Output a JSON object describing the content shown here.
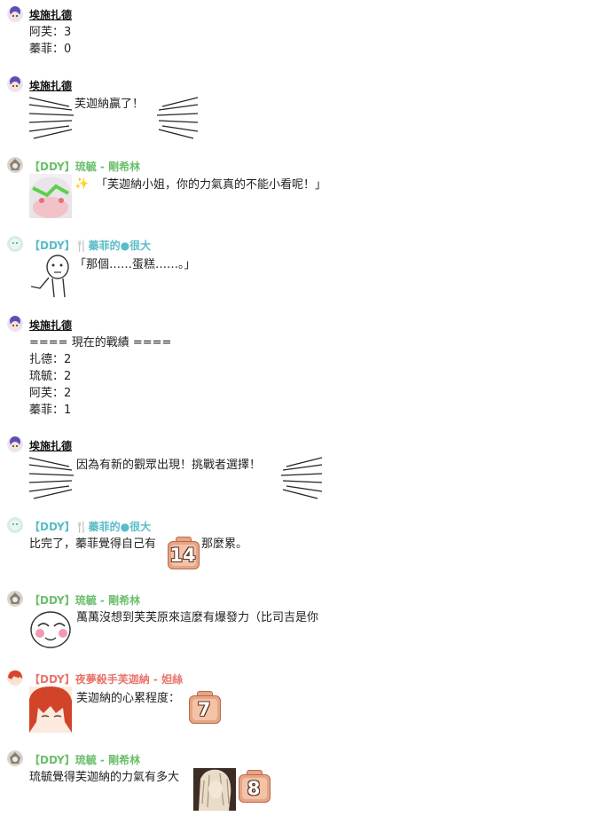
{
  "colors": {
    "ddy_green": "#6cbf6c",
    "ddy_teal": "#5bbcc8",
    "ddy_red": "#e8746c",
    "zhade_name": "#111111"
  },
  "messages": [
    {
      "author": "埃施扎德",
      "lines": [
        "阿芙：3",
        "蓁菲：0"
      ]
    },
    {
      "author": "埃施扎德",
      "lines": [
        "芙迦納贏了！"
      ]
    },
    {
      "author": "【DDY】琉毓 - 剛希林",
      "lines": [
        "「芙迦納小姐，你的力氣真的不能小看呢！」"
      ]
    },
    {
      "author": "【DDY】🍴蓁菲的●很大",
      "lines": [
        "「那個……蛋糕……。」"
      ]
    },
    {
      "author": "埃施扎德",
      "lines": [
        "==== 現在的戰績 ====",
        "扎德：2",
        "琉毓：2",
        "阿芙：2",
        "蓁菲：1"
      ]
    },
    {
      "author": "埃施扎德",
      "lines": [
        "因為有新的觀眾出現！挑戰者選擇！"
      ]
    },
    {
      "author": "【DDY】🍴蓁菲的●很大",
      "lines": [
        "比完了，蓁菲覺得自己有",
        "那麼累。"
      ],
      "dice": "14"
    },
    {
      "author": "【DDY】琉毓 - 剛希林",
      "lines": [
        "萬萬沒想到芙芙原來這麼有爆發力（比司吉是你"
      ]
    },
    {
      "author": "【DDY】夜夢殺手芙迦納 - 妲絲",
      "lines": [
        "芙迦納的心累程度："
      ],
      "dice": "7"
    },
    {
      "author": "【DDY】琉毓 - 剛希林",
      "lines": [
        "琉毓覺得芙迦納的力氣有多大"
      ],
      "dice": "8"
    }
  ]
}
